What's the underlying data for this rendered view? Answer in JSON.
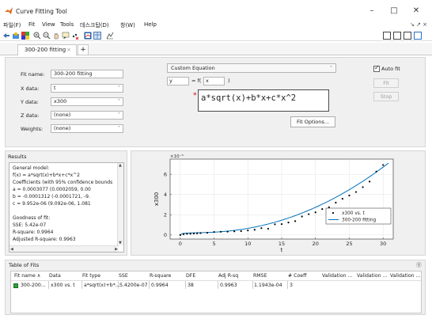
{
  "window": {
    "title": "Curve Fitting Tool",
    "min": "–",
    "max": "□",
    "close": "✕"
  },
  "menu": {
    "items": [
      "파일(F)",
      "Fit",
      "View",
      "Tools",
      "데스크탑(D)",
      "창(W)",
      "Help"
    ],
    "right": "↘ ↗ ×"
  },
  "tabs": {
    "active": "300-200 fitting",
    "close": "×",
    "add": "+"
  },
  "fit_settings": {
    "fit_name_label": "Fit name:",
    "fit_name": "300-200 fitting",
    "x_label": "X data:",
    "x_value": "t",
    "y_label": "Y data:",
    "y_value": "x300",
    "z_label": "Z data:",
    "z_value": "(none)",
    "weights_label": "Weights:",
    "weights_value": "(none)",
    "chevron": "˅"
  },
  "equation": {
    "type": "Custom Equation",
    "y_var": "y",
    "eq_sign": "= f(",
    "x_var": "x",
    "close_paren": ")",
    "star": "*",
    "expression": "a*sqrt(x)+b*x+c*x^2",
    "fit_options": "Fit Options...",
    "auto_fit": "Auto fit",
    "fit": "Fit",
    "stop": "Stop"
  },
  "results": {
    "header": "Results",
    "lines": [
      "General model:",
      "     f(x) = a*sqrt(x)+b*x+c*x^2",
      "Coefficients (with 95% confidence bounds",
      "       a =   0.0003077  (0.0002059, 0.00",
      "       b =  -0.0001312  (-0.0001721, -9.",
      "       c =   9.952e-06  (9.092e-06, 1.081",
      "",
      "Goodness of fit:",
      "  SSE: 5.42e-07",
      "  R-square: 0.9964",
      "  Adjusted R-square: 0.9963"
    ]
  },
  "chart_data": {
    "type": "scatter",
    "exponent_label": "×10⁻³",
    "xlabel": "t",
    "ylabel": "x300",
    "xlim": [
      -1.5,
      31.5
    ],
    "ylim": [
      -0.4,
      7.5
    ],
    "xticks": [
      0,
      5,
      10,
      15,
      20,
      25,
      30
    ],
    "yticks": [
      0,
      2,
      4,
      6
    ],
    "grid": true,
    "legend_position": "lower-right",
    "series": [
      {
        "name": "x300 vs. t",
        "type": "scatter",
        "color": "#000000",
        "x": [
          0,
          0.5,
          1,
          1.5,
          2,
          2.5,
          3,
          4,
          5,
          6,
          7,
          8,
          9,
          10,
          11,
          12,
          13,
          14,
          15,
          16,
          17,
          18,
          19,
          20,
          21,
          22,
          23,
          24,
          25,
          26,
          27,
          28,
          29,
          30
        ],
        "y": [
          0.0,
          0.09,
          0.12,
          0.13,
          0.15,
          0.17,
          0.19,
          0.22,
          0.3,
          0.32,
          0.33,
          0.36,
          0.38,
          0.45,
          0.52,
          0.68,
          0.62,
          1.06,
          1.08,
          1.23,
          1.37,
          1.83,
          2.06,
          2.24,
          2.56,
          2.74,
          3.2,
          3.58,
          3.9,
          4.25,
          4.73,
          5.28,
          6.27,
          6.92
        ]
      },
      {
        "name": "300-200 fitting",
        "type": "line",
        "color": "#0072bd",
        "coefficients": {
          "a": 0.0003077,
          "b": -0.0001312,
          "c": 9.952e-06
        },
        "scale": 1000
      }
    ]
  },
  "table_of_fits": {
    "header": "Table of Fits",
    "columns": [
      "Fit name ∧",
      "Data",
      "Fit type",
      "SSE",
      "R-square",
      "DFE",
      "Adj R-sq",
      "RMSE",
      "# Coeff",
      "Validation ...",
      "Validation ...",
      "Validation ..."
    ],
    "rows": [
      [
        "300-200...",
        "x300 vs. t",
        "a*sqrt(x)+b*...",
        "5.4200e-07",
        "0.9964",
        "38",
        "0.9963",
        "1.1943e-04",
        "3",
        "",
        "",
        ""
      ]
    ],
    "row_color": "#2ea23a"
  }
}
